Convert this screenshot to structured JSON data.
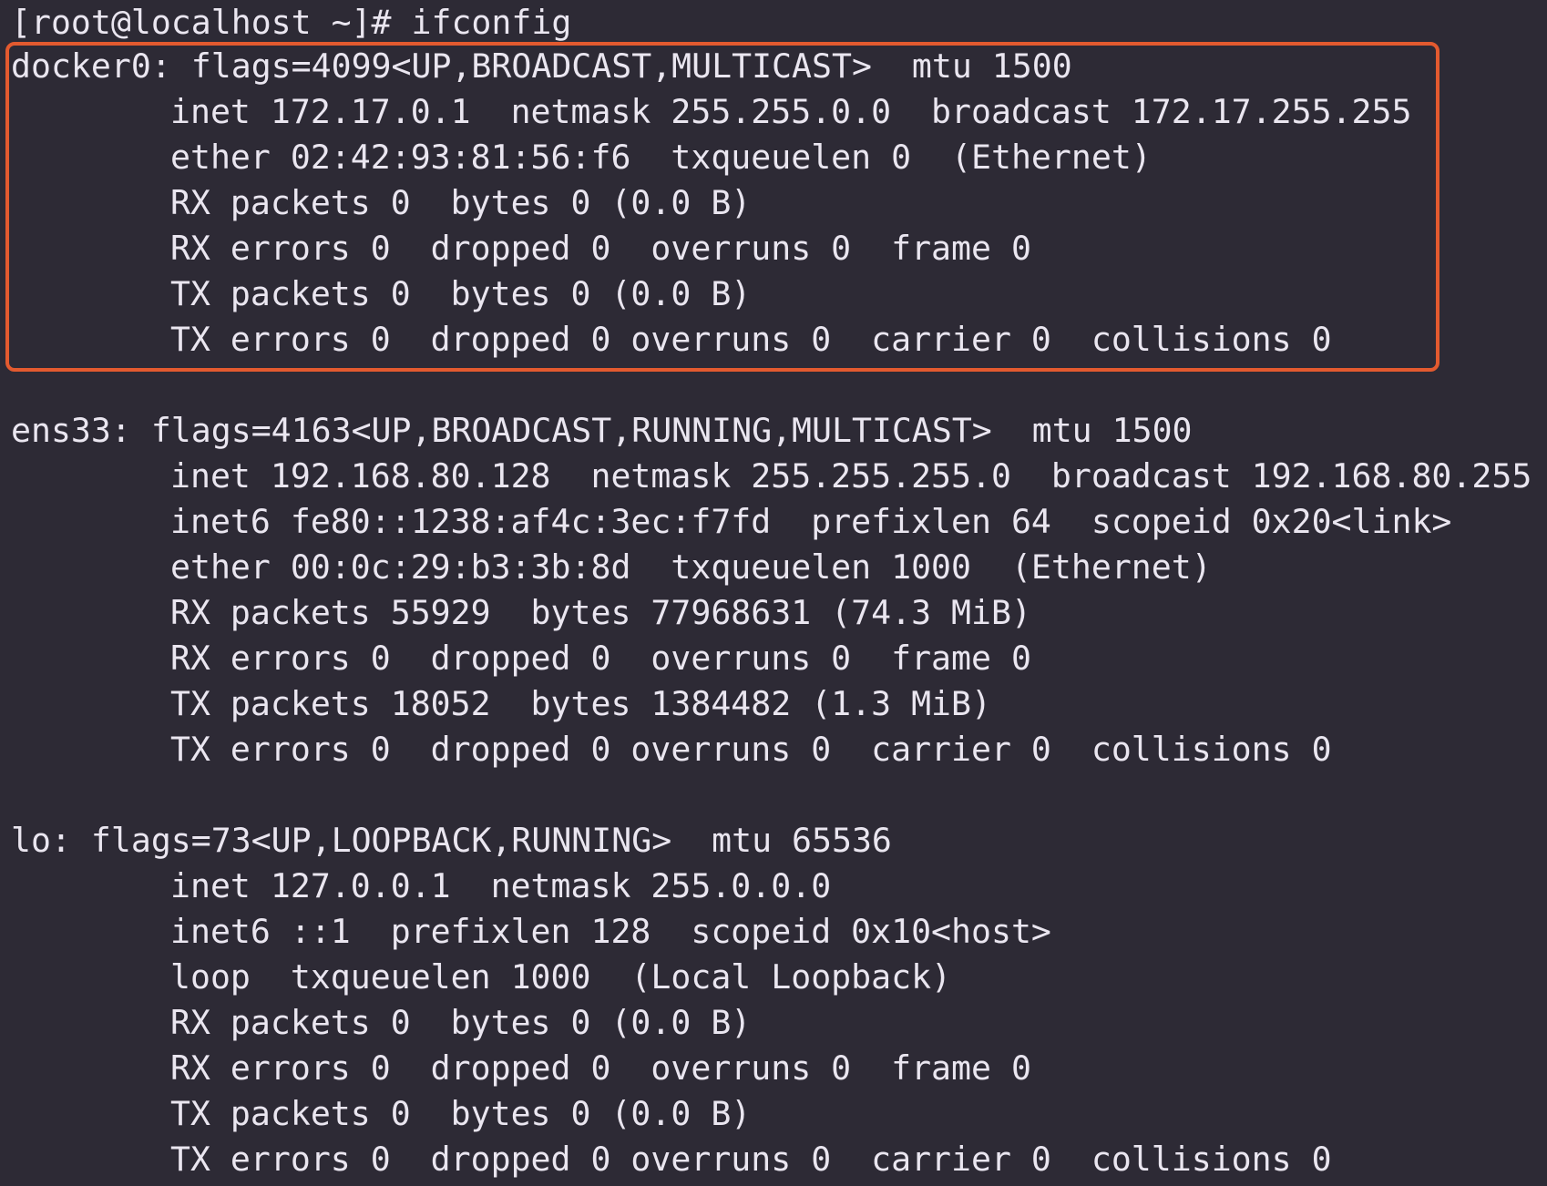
{
  "terminal": {
    "prompt": "[root@localhost ~]# ifconfig",
    "highlight_color": "#e35a2f",
    "interfaces": [
      {
        "header": "docker0: flags=4099<UP,BROADCAST,MULTICAST>  mtu 1500",
        "details": [
          "inet 172.17.0.1  netmask 255.255.0.0  broadcast 172.17.255.255",
          "ether 02:42:93:81:56:f6  txqueuelen 0  (Ethernet)",
          "RX packets 0  bytes 0 (0.0 B)",
          "RX errors 0  dropped 0  overruns 0  frame 0",
          "TX packets 0  bytes 0 (0.0 B)",
          "TX errors 0  dropped 0 overruns 0  carrier 0  collisions 0"
        ]
      },
      {
        "header": "ens33: flags=4163<UP,BROADCAST,RUNNING,MULTICAST>  mtu 1500",
        "details": [
          "inet 192.168.80.128  netmask 255.255.255.0  broadcast 192.168.80.255",
          "inet6 fe80::1238:af4c:3ec:f7fd  prefixlen 64  scopeid 0x20<link>",
          "ether 00:0c:29:b3:3b:8d  txqueuelen 1000  (Ethernet)",
          "RX packets 55929  bytes 77968631 (74.3 MiB)",
          "RX errors 0  dropped 0  overruns 0  frame 0",
          "TX packets 18052  bytes 1384482 (1.3 MiB)",
          "TX errors 0  dropped 0 overruns 0  carrier 0  collisions 0"
        ]
      },
      {
        "header": "lo: flags=73<UP,LOOPBACK,RUNNING>  mtu 65536",
        "details": [
          "inet 127.0.0.1  netmask 255.0.0.0",
          "inet6 ::1  prefixlen 128  scopeid 0x10<host>",
          "loop  txqueuelen 1000  (Local Loopback)",
          "RX packets 0  bytes 0 (0.0 B)",
          "RX errors 0  dropped 0  overruns 0  frame 0",
          "TX packets 0  bytes 0 (0.0 B)",
          "TX errors 0  dropped 0 overruns 0  carrier 0  collisions 0"
        ]
      }
    ]
  }
}
